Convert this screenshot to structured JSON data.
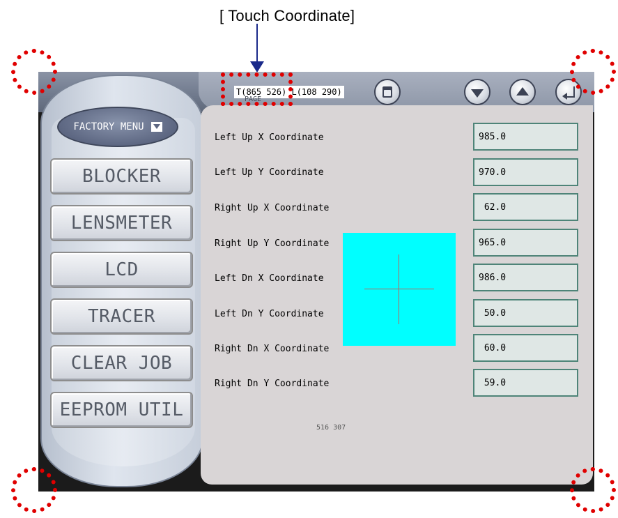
{
  "annotation": {
    "title": "[ Touch Coordinate]"
  },
  "toolbar": {
    "touch_readout": "T(865 526)",
    "lens_readout": "L(108 290)",
    "page_label": "PAGE",
    "icons": [
      "save-icon",
      "arrow-down-icon",
      "arrow-up-icon",
      "return-icon"
    ]
  },
  "sidebar": {
    "factory_menu_label": "FACTORY MENU",
    "items": [
      {
        "label": "BLOCKER"
      },
      {
        "label": "LENSMETER"
      },
      {
        "label": "LCD"
      },
      {
        "label": "TRACER"
      },
      {
        "label": "CLEAR JOB"
      },
      {
        "label": "EEPROM UTIL"
      }
    ]
  },
  "calibration": {
    "rows": [
      {
        "label": "Left Up X Coordinate",
        "value": "985.0"
      },
      {
        "label": "Left Up Y Coordinate",
        "value": "970.0"
      },
      {
        "label": "Right Up X Coordinate",
        "value": " 62.0"
      },
      {
        "label": "Right Up Y Coordinate",
        "value": "965.0"
      },
      {
        "label": "Left Dn X Coordinate",
        "value": "986.0"
      },
      {
        "label": "Left Dn Y Coordinate",
        "value": " 50.0"
      },
      {
        "label": "Right Dn X Coordinate",
        "value": " 60.0"
      },
      {
        "label": "Right Dn Y Coordinate",
        "value": " 59.0"
      }
    ],
    "center_readout": "516 307",
    "target_color": "#00ffff"
  },
  "colors": {
    "annotation_red": "#e00000",
    "value_border": "#4e8478",
    "content_bg": "#d9d5d6"
  }
}
